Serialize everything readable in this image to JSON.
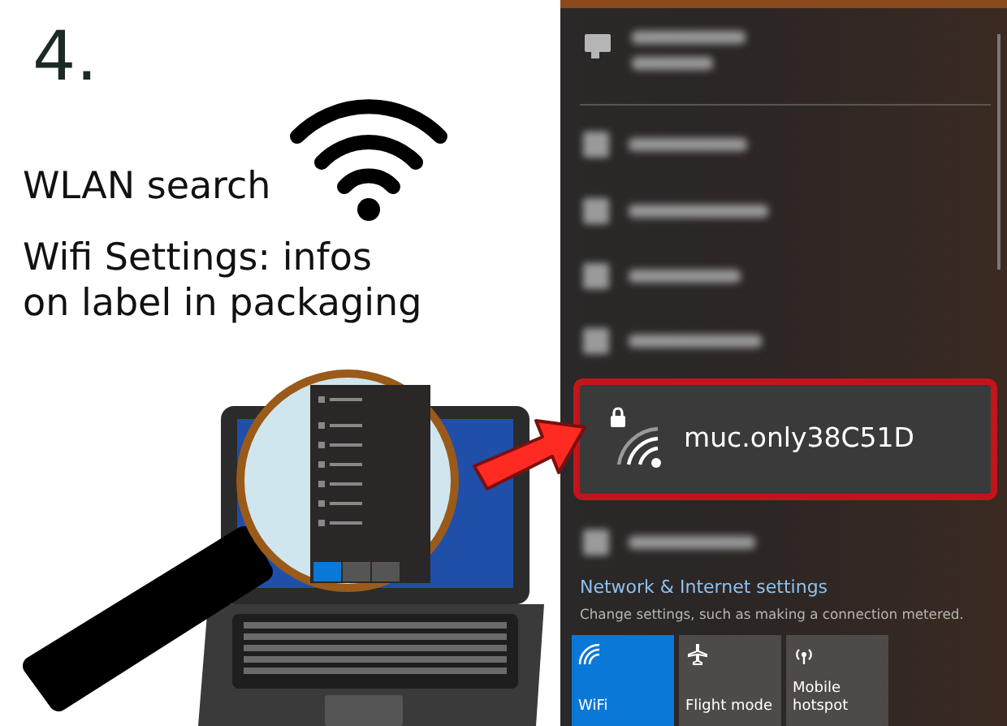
{
  "step": {
    "number": "4."
  },
  "instructions": [
    {
      "text": "WLAN search"
    },
    {
      "text": "Wifi Settings: infos"
    },
    {
      "text": "on label in packaging"
    }
  ],
  "flyout": {
    "networks": [
      {
        "kind": "wired",
        "highlighted": false
      },
      {
        "kind": "wifi",
        "highlighted": false
      },
      {
        "kind": "wifi",
        "highlighted": false
      },
      {
        "kind": "wifi",
        "highlighted": false
      },
      {
        "kind": "wifi",
        "highlighted": false
      },
      {
        "kind": "wifi",
        "name": "muc.only38C51D",
        "secured": true,
        "highlighted": true
      },
      {
        "kind": "wifi",
        "highlighted": false
      }
    ],
    "settings_link": "Network & Internet settings",
    "settings_hint": "Change settings, such as making a connection metered.",
    "tiles": [
      {
        "kind": "wifi",
        "label": "WiFi",
        "on": true
      },
      {
        "kind": "airplane",
        "label": "Flight mode",
        "on": false
      },
      {
        "kind": "hotspot",
        "label": "Mobile hotspot",
        "on": false
      }
    ]
  }
}
